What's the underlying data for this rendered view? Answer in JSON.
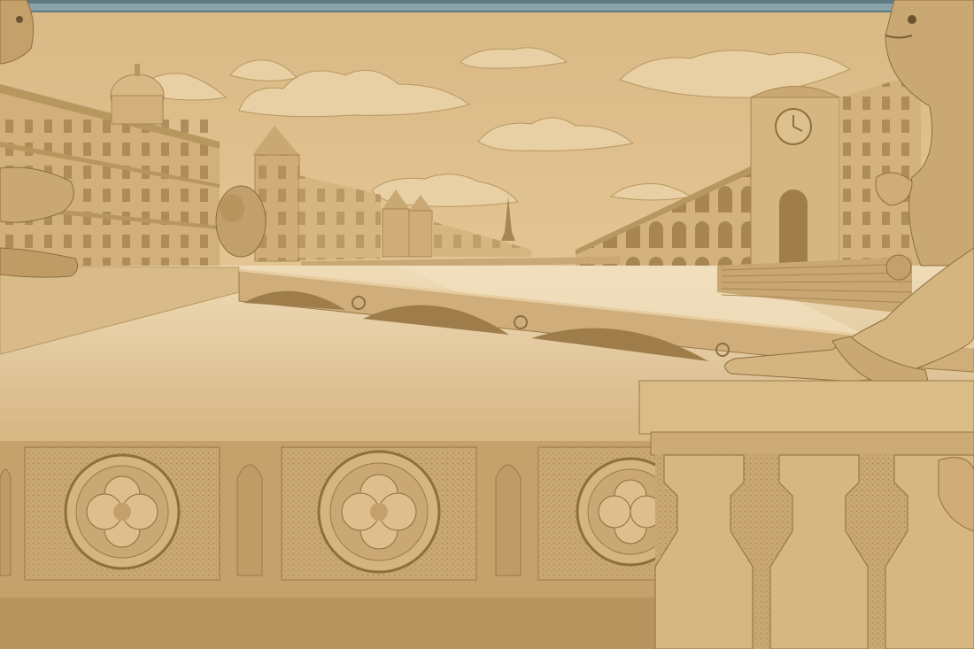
{
  "scene": {
    "subject": "sand-sculpture",
    "colors": {
      "sand_light": "#e6cc9e",
      "sand_mid": "#cfae7c",
      "sand_dark": "#a9864f",
      "sand_shadow": "#7d5f35",
      "window_frame": "#5f7a82"
    }
  }
}
